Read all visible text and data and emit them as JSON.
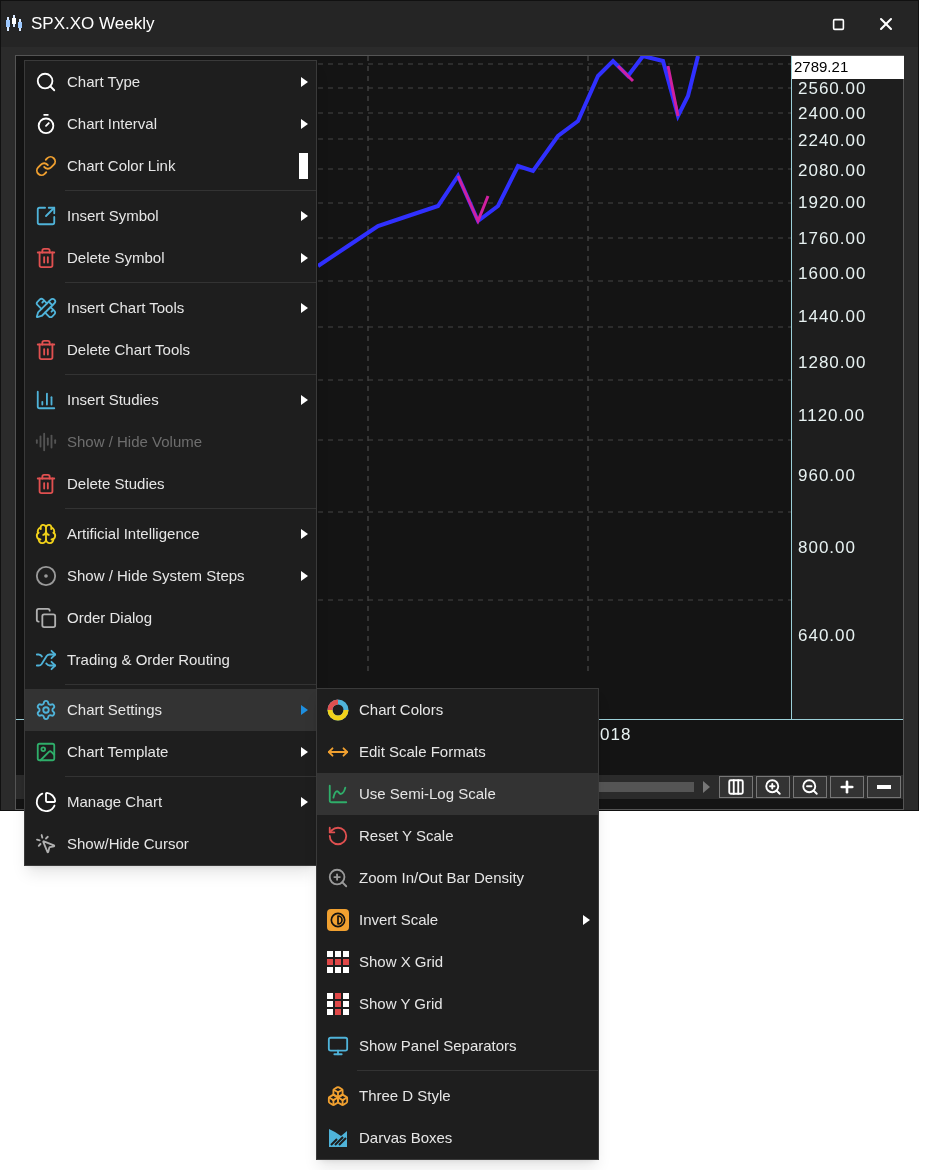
{
  "window": {
    "title": "SPX.XO Weekly"
  },
  "chart": {
    "last_price": "2789.21",
    "y_axis_labels": [
      "2560.00",
      "2400.00",
      "2240.00",
      "2080.00",
      "1920.00",
      "1760.00",
      "1600.00",
      "1440.00",
      "1280.00",
      "1120.00",
      "960.00",
      "800.00",
      "640.00"
    ],
    "x_axis_labels": [
      "018"
    ]
  },
  "context_menu": {
    "sections": [
      {
        "items": [
          {
            "label": "Chart Type",
            "kind": "submenu",
            "disabled": false,
            "selected": false
          },
          {
            "label": "Chart Interval",
            "kind": "submenu",
            "disabled": false,
            "selected": false
          },
          {
            "label": "Chart Color Link",
            "kind": "swatch",
            "disabled": false,
            "selected": false
          }
        ]
      },
      {
        "items": [
          {
            "label": "Insert Symbol",
            "kind": "submenu",
            "disabled": false,
            "selected": false
          },
          {
            "label": "Delete Symbol",
            "kind": "submenu",
            "disabled": false,
            "selected": false
          }
        ]
      },
      {
        "items": [
          {
            "label": "Insert Chart Tools",
            "kind": "submenu",
            "disabled": false,
            "selected": false
          },
          {
            "label": "Delete Chart Tools",
            "kind": "action",
            "disabled": false,
            "selected": false
          }
        ]
      },
      {
        "items": [
          {
            "label": "Insert Studies",
            "kind": "submenu",
            "disabled": false,
            "selected": false
          },
          {
            "label": "Show / Hide Volume",
            "kind": "action",
            "disabled": true,
            "selected": false
          },
          {
            "label": "Delete Studies",
            "kind": "action",
            "disabled": false,
            "selected": false
          }
        ]
      },
      {
        "items": [
          {
            "label": "Artificial Intelligence",
            "kind": "submenu",
            "disabled": false,
            "selected": false
          },
          {
            "label": "Show / Hide System Steps",
            "kind": "submenu",
            "disabled": false,
            "selected": false
          },
          {
            "label": "Order Dialog",
            "kind": "action",
            "disabled": false,
            "selected": false
          },
          {
            "label": "Trading & Order Routing",
            "kind": "action",
            "disabled": false,
            "selected": false
          }
        ]
      },
      {
        "items": [
          {
            "label": "Chart Settings",
            "kind": "submenu",
            "disabled": false,
            "selected": true
          },
          {
            "label": "Chart Template",
            "kind": "submenu",
            "disabled": false,
            "selected": false
          }
        ]
      },
      {
        "items": [
          {
            "label": "Manage Chart",
            "kind": "submenu",
            "disabled": false,
            "selected": false
          },
          {
            "label": "Show/Hide Cursor",
            "kind": "action",
            "disabled": false,
            "selected": false
          }
        ]
      }
    ]
  },
  "submenu": {
    "sections": [
      {
        "items": [
          {
            "label": "Chart Colors",
            "kind": "action",
            "disabled": false,
            "selected": false
          },
          {
            "label": "Edit Scale Formats",
            "kind": "action",
            "disabled": false,
            "selected": false
          },
          {
            "label": "Use Semi-Log Scale",
            "kind": "action",
            "disabled": false,
            "selected": true
          },
          {
            "label": "Reset Y Scale",
            "kind": "action",
            "disabled": false,
            "selected": false
          },
          {
            "label": "Zoom In/Out Bar Density",
            "kind": "action",
            "disabled": false,
            "selected": false
          },
          {
            "label": "Invert Scale",
            "kind": "submenu",
            "disabled": false,
            "selected": false
          },
          {
            "label": "Show X Grid",
            "kind": "action",
            "disabled": false,
            "selected": false
          },
          {
            "label": "Show Y Grid",
            "kind": "action",
            "disabled": false,
            "selected": false
          },
          {
            "label": "Show Panel Separators",
            "kind": "action",
            "disabled": false,
            "selected": false
          }
        ]
      },
      {
        "items": [
          {
            "label": "Three D Style",
            "kind": "action",
            "disabled": false,
            "selected": false
          },
          {
            "label": "Darvas Boxes",
            "kind": "action",
            "disabled": false,
            "selected": false
          }
        ]
      }
    ]
  }
}
